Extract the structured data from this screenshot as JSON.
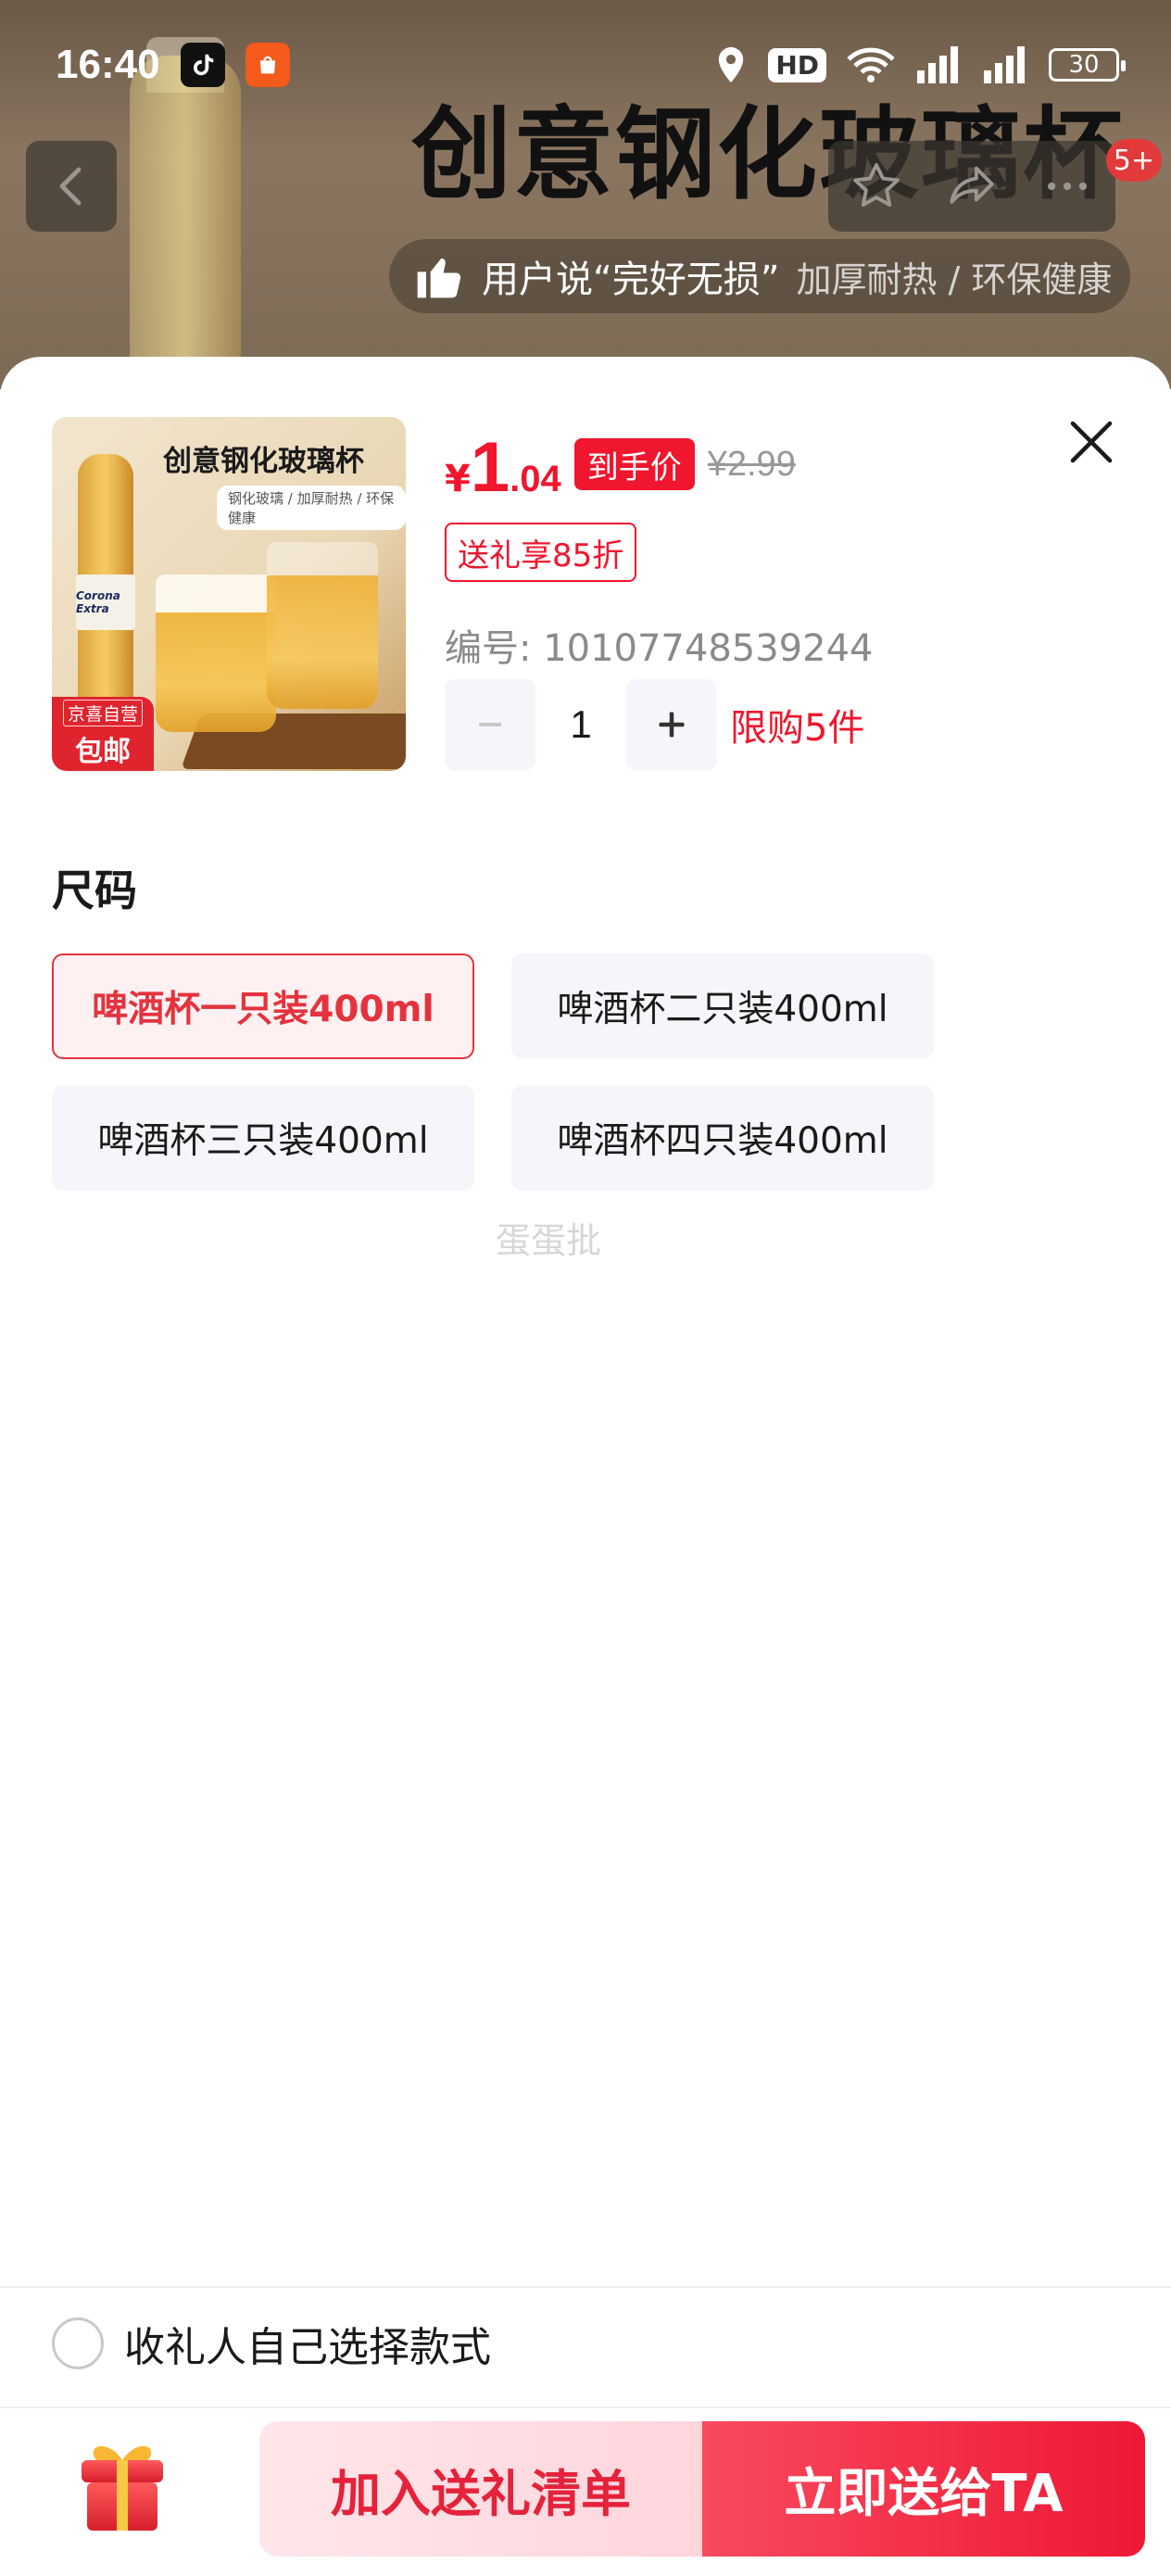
{
  "status_bar": {
    "time": "16:40",
    "hd": "HD",
    "battery": "30"
  },
  "background": {
    "product_title": "创意钢化玻璃杯",
    "claim_main": "用户说“完好无损”",
    "claim_sub": "加厚耐热 / 环保健康",
    "cart_badge": "5+"
  },
  "product": {
    "thumb_title": "创意钢化玻璃杯",
    "thumb_subtitle": "钢化玻璃 / 加厚耐热 / 环保健康",
    "thumb_bottle_label": "Corona Extra",
    "tag_line1": "京喜自营",
    "tag_line2": "包邮",
    "price_symbol": "¥",
    "price_int": "1",
    "price_dec": ".04",
    "price_tag": "到手价",
    "original_price": "¥2.99",
    "gift_discount": "送礼享85折",
    "sku_id": "编号: 10107748539244",
    "quantity": "1",
    "purchase_limit": "限购5件"
  },
  "size_section": {
    "title": "尺码",
    "options": [
      {
        "label": "啤酒杯一只装400ml",
        "selected": true
      },
      {
        "label": "啤酒杯二只装400ml",
        "selected": false
      },
      {
        "label": "啤酒杯三只装400ml",
        "selected": false
      },
      {
        "label": "啤酒杯四只装400ml",
        "selected": false
      }
    ]
  },
  "watermark": "蛋蛋批",
  "footer": {
    "recipient_choice": "收礼人自己选择款式",
    "add_button": "加入送礼清单",
    "send_button": "立即送给TA"
  },
  "colors": {
    "accent_red": "#f0162e",
    "selected_bg": "#fff1f2",
    "option_bg": "#f5f6fa"
  },
  "icons": [
    "back-icon",
    "star-icon",
    "share-icon",
    "more-icon",
    "close-icon",
    "gift-box-icon",
    "thumbs-up-icon",
    "location-icon",
    "wifi-icon",
    "signal-icon"
  ]
}
